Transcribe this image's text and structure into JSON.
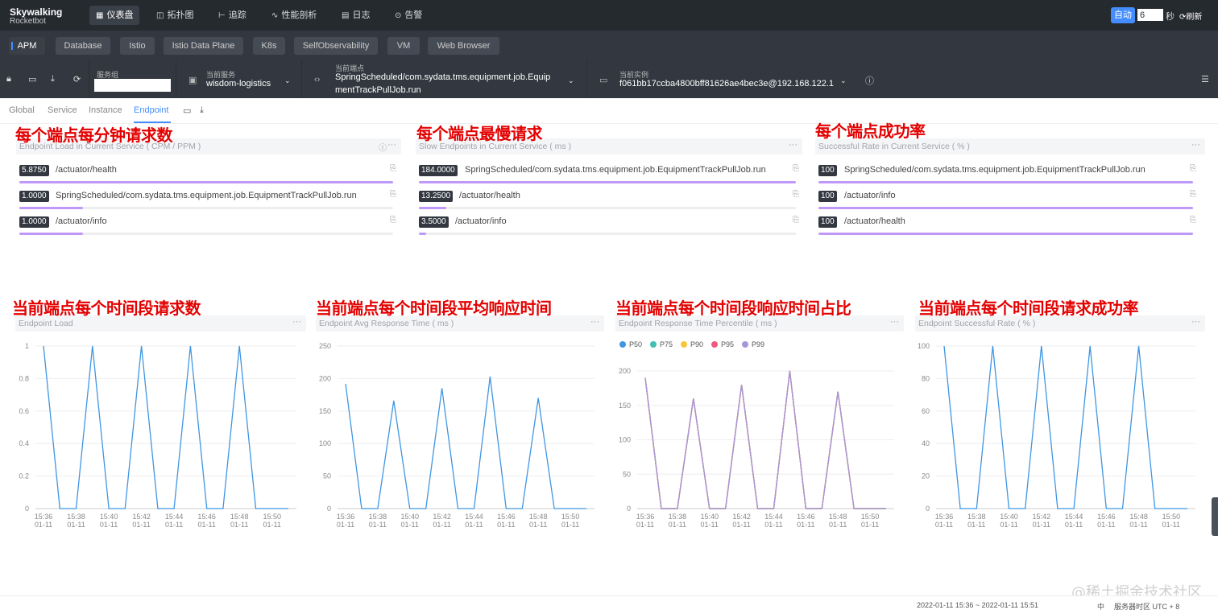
{
  "app": {
    "logo_line1": "Skywalking",
    "logo_line2": "Rocketbot",
    "nav": [
      {
        "label": "仪表盘",
        "icon": "dashboard-icon",
        "active": true
      },
      {
        "label": "拓扑图",
        "icon": "topology-icon"
      },
      {
        "label": "追踪",
        "icon": "trace-icon"
      },
      {
        "label": "性能剖析",
        "icon": "profile-icon"
      },
      {
        "label": "日志",
        "icon": "log-icon"
      },
      {
        "label": "告警",
        "icon": "alarm-icon"
      }
    ],
    "auto_label": "自动",
    "interval_value": "6",
    "seconds_label": "秒",
    "refresh_label": "刷新"
  },
  "layers": [
    "APM",
    "Database",
    "Istio",
    "Istio Data Plane",
    "K8s",
    "SelfObservability",
    "VM",
    "Web Browser"
  ],
  "selectors": {
    "group_label": "服务组",
    "group_value": "",
    "service_label": "当前服务",
    "service_value": "wisdom-logistics",
    "endpoint_label": "当前端点",
    "endpoint_value_line1": "SpringScheduled/com.sydata.tms.equipment.job.Equip",
    "endpoint_value_line2": "mentTrackPullJob.run",
    "instance_label": "当前实例",
    "instance_value": "f061bb17ccba4800bff81626ae4bec3e@192.168.122.1"
  },
  "tabs": [
    "Global",
    "Service",
    "Instance",
    "Endpoint"
  ],
  "annotations": {
    "a1": "每个端点每分钟请求数",
    "a2": "每个端点最慢请求",
    "a3": "每个端点成功率",
    "a4": "当前端点每个时间段请求数",
    "a5": "当前端点每个时间段平均响应时间",
    "a6": "当前端点每个时间段响应时间占比",
    "a7": "当前端点每个时间段请求成功率"
  },
  "lists": [
    {
      "title": "Endpoint Load in Current Service ( CPM / PPM )",
      "rows": [
        {
          "value": "5.8750",
          "name": "/actuator/health",
          "fraction": 1.0
        },
        {
          "value": "1.0000",
          "name": "SpringScheduled/com.sydata.tms.equipment.job.EquipmentTrackPullJob.run",
          "fraction": 0.17
        },
        {
          "value": "1.0000",
          "name": "/actuator/info",
          "fraction": 0.17
        }
      ]
    },
    {
      "title": "Slow Endpoints in Current Service ( ms )",
      "rows": [
        {
          "value": "184.0000",
          "name": "SpringScheduled/com.sydata.tms.equipment.job.EquipmentTrackPullJob.run",
          "fraction": 1.0
        },
        {
          "value": "13.2500",
          "name": "/actuator/health",
          "fraction": 0.072
        },
        {
          "value": "3.5000",
          "name": "/actuator/info",
          "fraction": 0.019
        }
      ]
    },
    {
      "title": "Successful Rate in Current Service ( % )",
      "rows": [
        {
          "value": "100",
          "name": "SpringScheduled/com.sydata.tms.equipment.job.EquipmentTrackPullJob.run",
          "fraction": 1.0
        },
        {
          "value": "100",
          "name": "/actuator/info",
          "fraction": 1.0
        },
        {
          "value": "100",
          "name": "/actuator/health",
          "fraction": 1.0
        }
      ]
    }
  ],
  "chart_data": [
    {
      "type": "line",
      "title": "Endpoint Load",
      "x_ticks": [
        "15:36\n01-11",
        "15:38\n01-11",
        "15:40\n01-11",
        "15:42\n01-11",
        "15:44\n01-11",
        "15:46\n01-11",
        "15:48\n01-11",
        "15:50\n01-11"
      ],
      "ylim": [
        0,
        1
      ],
      "y_ticks": [
        "0",
        "0.2",
        "0.4",
        "0.6",
        "0.8",
        "1"
      ],
      "series": [
        {
          "color": "#3f96e3",
          "values": [
            1,
            0,
            0,
            1,
            0,
            0,
            1,
            0,
            0,
            1,
            0,
            0,
            1,
            0,
            0,
            0
          ]
        }
      ]
    },
    {
      "type": "line",
      "title": "Endpoint Avg Response Time ( ms )",
      "x_ticks": [
        "15:36\n01-11",
        "15:38\n01-11",
        "15:40\n01-11",
        "15:42\n01-11",
        "15:44\n01-11",
        "15:46\n01-11",
        "15:48\n01-11",
        "15:50\n01-11"
      ],
      "ylim": [
        0,
        250
      ],
      "y_ticks": [
        "0",
        "50",
        "100",
        "150",
        "200",
        "250"
      ],
      "series": [
        {
          "color": "#3f96e3",
          "values": [
            192,
            0,
            0,
            166,
            0,
            0,
            185,
            0,
            0,
            203,
            0,
            0,
            170,
            0,
            0,
            0
          ]
        }
      ]
    },
    {
      "type": "line",
      "title": "Endpoint Response Time Percentile ( ms )",
      "legend": [
        "P50",
        "P75",
        "P90",
        "P95",
        "P99"
      ],
      "x_ticks": [
        "15:36\n01-11",
        "15:38\n01-11",
        "15:40\n01-11",
        "15:42\n01-11",
        "15:44\n01-11",
        "15:46\n01-11",
        "15:48\n01-11",
        "15:50\n01-11"
      ],
      "ylim": [
        0,
        200
      ],
      "y_ticks": [
        "0",
        "50",
        "100",
        "150",
        "200"
      ],
      "series": [
        {
          "name": "P50",
          "color": "#3f96e3",
          "values": [
            190,
            0,
            0,
            160,
            0,
            0,
            180,
            0,
            0,
            200,
            0,
            0,
            170,
            0,
            0,
            0
          ]
        },
        {
          "name": "P75",
          "color": "#3fbfb0",
          "values": [
            190,
            0,
            0,
            160,
            0,
            0,
            180,
            0,
            0,
            200,
            0,
            0,
            170,
            0,
            0,
            0
          ]
        },
        {
          "name": "P90",
          "color": "#f7c63a",
          "values": [
            190,
            0,
            0,
            160,
            0,
            0,
            180,
            0,
            0,
            200,
            0,
            0,
            170,
            0,
            0,
            0
          ]
        },
        {
          "name": "P95",
          "color": "#ee5a7d",
          "values": [
            190,
            0,
            0,
            160,
            0,
            0,
            180,
            0,
            0,
            200,
            0,
            0,
            170,
            0,
            0,
            0
          ]
        },
        {
          "name": "P99",
          "color": "#a797d6",
          "values": [
            190,
            0,
            0,
            160,
            0,
            0,
            180,
            0,
            0,
            200,
            0,
            0,
            170,
            0,
            0,
            0
          ]
        }
      ]
    },
    {
      "type": "line",
      "title": "Endpoint Successful Rate ( % )",
      "x_ticks": [
        "15:36\n01-11",
        "15:38\n01-11",
        "15:40\n01-11",
        "15:42\n01-11",
        "15:44\n01-11",
        "15:46\n01-11",
        "15:48\n01-11",
        "15:50\n01-11"
      ],
      "ylim": [
        0,
        100
      ],
      "y_ticks": [
        "0",
        "20",
        "40",
        "60",
        "80",
        "100"
      ],
      "series": [
        {
          "color": "#3f96e3",
          "values": [
            100,
            0,
            0,
            100,
            0,
            0,
            100,
            0,
            0,
            100,
            0,
            0,
            100,
            0,
            0,
            0
          ]
        }
      ]
    }
  ],
  "footer": {
    "range": "2022-01-11 15:36 ~ 2022-01-11 15:51",
    "lang": "中",
    "timezone": "服务器时区 UTC + 8",
    "watermark": "@稀土掘金技术社区"
  }
}
